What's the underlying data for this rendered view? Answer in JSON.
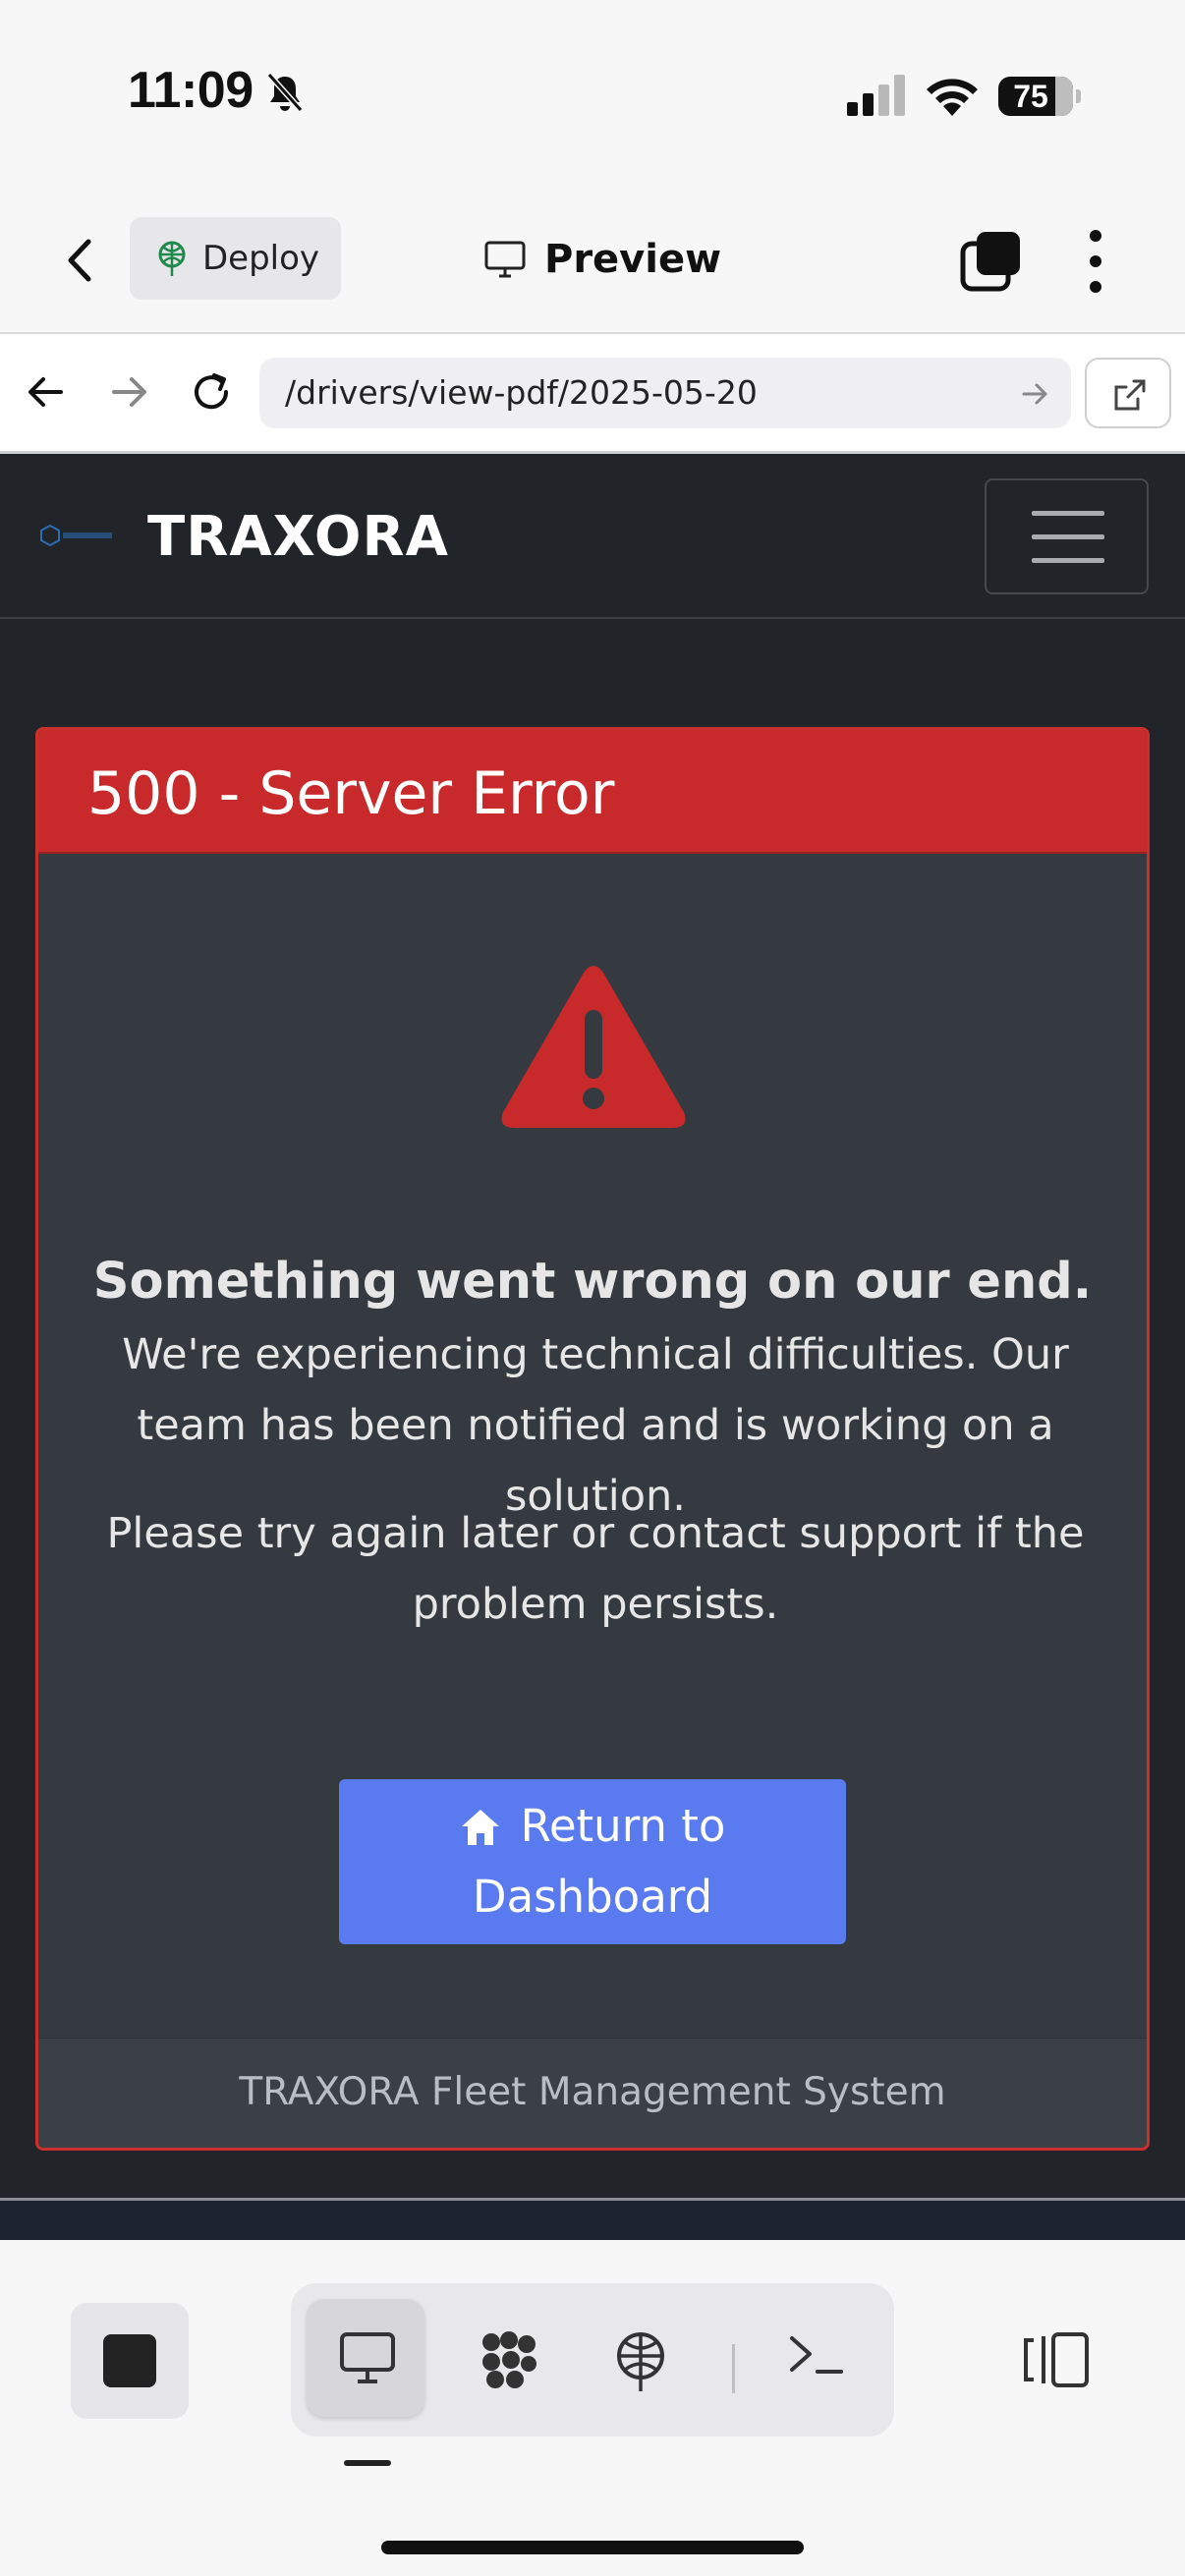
{
  "status_bar": {
    "time": "11:09",
    "battery": "75"
  },
  "app_header": {
    "deploy_label": "Deploy",
    "preview_label": "Preview"
  },
  "browser": {
    "url": "/drivers/view-pdf/2025-05-20"
  },
  "site": {
    "brand": "TRAXORA",
    "error_title": "500 - Server Error",
    "headline": "Something went wrong on our end.",
    "message1": "We're experiencing technical difficulties. Our team has been notified and is working on a solution.",
    "message2": "Please try again later or contact support if the problem persists.",
    "button_label": "Return to Dashboard",
    "footer": "TRAXORA Fleet Management System"
  },
  "colors": {
    "error_red": "#c8292b",
    "button_blue": "#5a7bf0",
    "page_dark": "#212529",
    "card_dark": "#343a40"
  }
}
